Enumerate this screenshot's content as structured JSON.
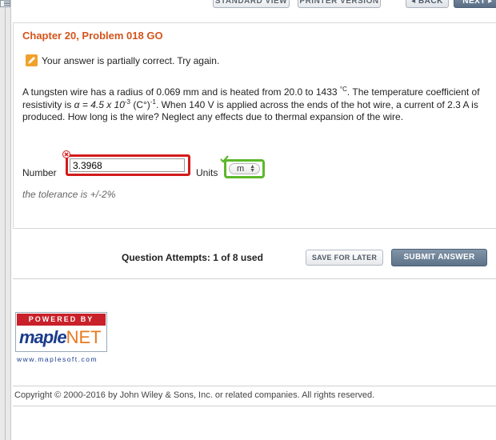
{
  "toolbar": {
    "standard_view": "STANDARD VIEW",
    "printer_version": "PRINTER VERSION",
    "back": "◂ BACK",
    "next": "NEXT ▸"
  },
  "problem": {
    "title": "Chapter 20, Problem 018 GO",
    "status": "Your answer is partially correct.  Try again.",
    "text_part1": "A tungsten wire has a radius of 0.069 mm and is heated from 20.0 to 1433 ",
    "degree_c": "°C",
    "text_part2": ". The temperature coefficient of resistivity is ",
    "alpha_eq": "α = 4.5 x 10",
    "exp_neg3": "-3",
    "unit_c": " (C°)",
    "exp_neg1": "-1",
    "text_part3": ". When 140 V is applied across the ends of the hot wire, a current of 2.3 A is produced. How long is the wire? Neglect any effects due to thermal expansion of the wire."
  },
  "answer": {
    "number_label": "Number",
    "number_value": "3.3968",
    "units_label": "Units",
    "units_value": "m",
    "tolerance": "the tolerance is +/-2%"
  },
  "footer": {
    "attempts": "Question Attempts: 1 of 8 used",
    "save_label": "SAVE FOR LATER",
    "submit_label": "SUBMIT ANSWER"
  },
  "logo": {
    "powered_by": "POWERED BY",
    "brand": "maple",
    "brand_suffix": "NET",
    "url": "www.maplesoft.com"
  },
  "copyright": "Copyright © 2000-2016 by John Wiley & Sons, Inc. or related companies. All rights reserved.",
  "colors": {
    "title": "#d4541b",
    "error_border": "#d31b1b",
    "correct_border": "#5cb82a",
    "submit_bg": "#5e7389"
  }
}
